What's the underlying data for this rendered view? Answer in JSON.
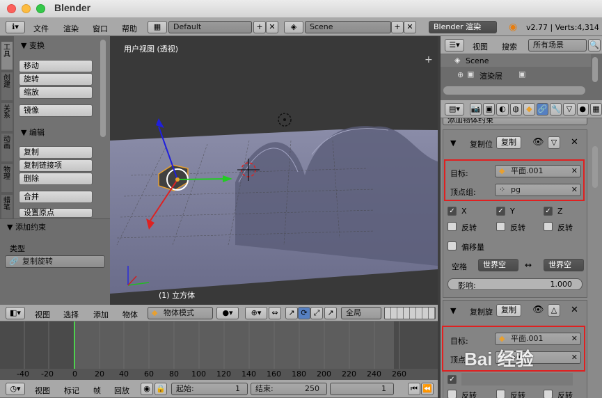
{
  "app": {
    "title": "Blender"
  },
  "info_header": {
    "menus": [
      "文件",
      "渲染",
      "窗口",
      "帮助"
    ],
    "screen": "Default",
    "scene": "Scene",
    "engine": "Blender 渲染",
    "stats": "v2.77 | Verts:4,314"
  },
  "tool_tabs": [
    "工具",
    "创建",
    "关系",
    "动画",
    "物理",
    "蜡笔"
  ],
  "tools": {
    "transform_title": "▼ 变换",
    "move": "移动",
    "rotate": "旋转",
    "scale": "缩放",
    "mirror": "镜像",
    "edit_title": "▼ 编辑",
    "duplicate": "复制",
    "duplicate_linked": "复制链接项",
    "delete": "删除",
    "join": "合并",
    "set_origin": "设置原点"
  },
  "operator": {
    "title": "▼ 添加约束",
    "type_label": "类型",
    "type_value": "复制旋转"
  },
  "viewport": {
    "label": "用户视图 (透视)",
    "object_label": "(1) 立方体"
  },
  "view3d_header": {
    "menus": [
      "视图",
      "选择",
      "添加",
      "物体"
    ],
    "mode": "物体模式",
    "orientation": "全局"
  },
  "outliner": {
    "menus": [
      "视图",
      "搜索"
    ],
    "filter": "所有场景",
    "scene": "Scene",
    "render_layer": "渲染层"
  },
  "properties": {
    "add_constraint": "添加物体约束",
    "c1": {
      "name": "复制位",
      "apply": "复制",
      "target_label": "目标:",
      "target": "平面.001",
      "vgroup_label": "顶点组:",
      "vgroup": "pg",
      "x": "X",
      "y": "Y",
      "z": "Z",
      "invert": "反转",
      "offset": "偏移量",
      "space_label": "空格",
      "space1": "世界空",
      "space2": "世界空",
      "influence_label": "影响:",
      "influence": "1.000"
    },
    "c2": {
      "name": "复制旋",
      "apply": "复制",
      "target_label": "目标:",
      "target": "平面.001",
      "vgroup_label": "顶点",
      "vgroup": "pg",
      "invert": "反转"
    }
  },
  "timeline": {
    "ticks": [
      "-40",
      "-20",
      "0",
      "20",
      "40",
      "60",
      "80",
      "100",
      "120",
      "140",
      "160",
      "180",
      "200",
      "220",
      "240",
      "260"
    ],
    "menus": [
      "视图",
      "标记",
      "帧",
      "回放"
    ],
    "start_label": "起始:",
    "start": "1",
    "end_label": "结束:",
    "end": "250",
    "current": "1"
  },
  "watermark": "Bai 经验"
}
